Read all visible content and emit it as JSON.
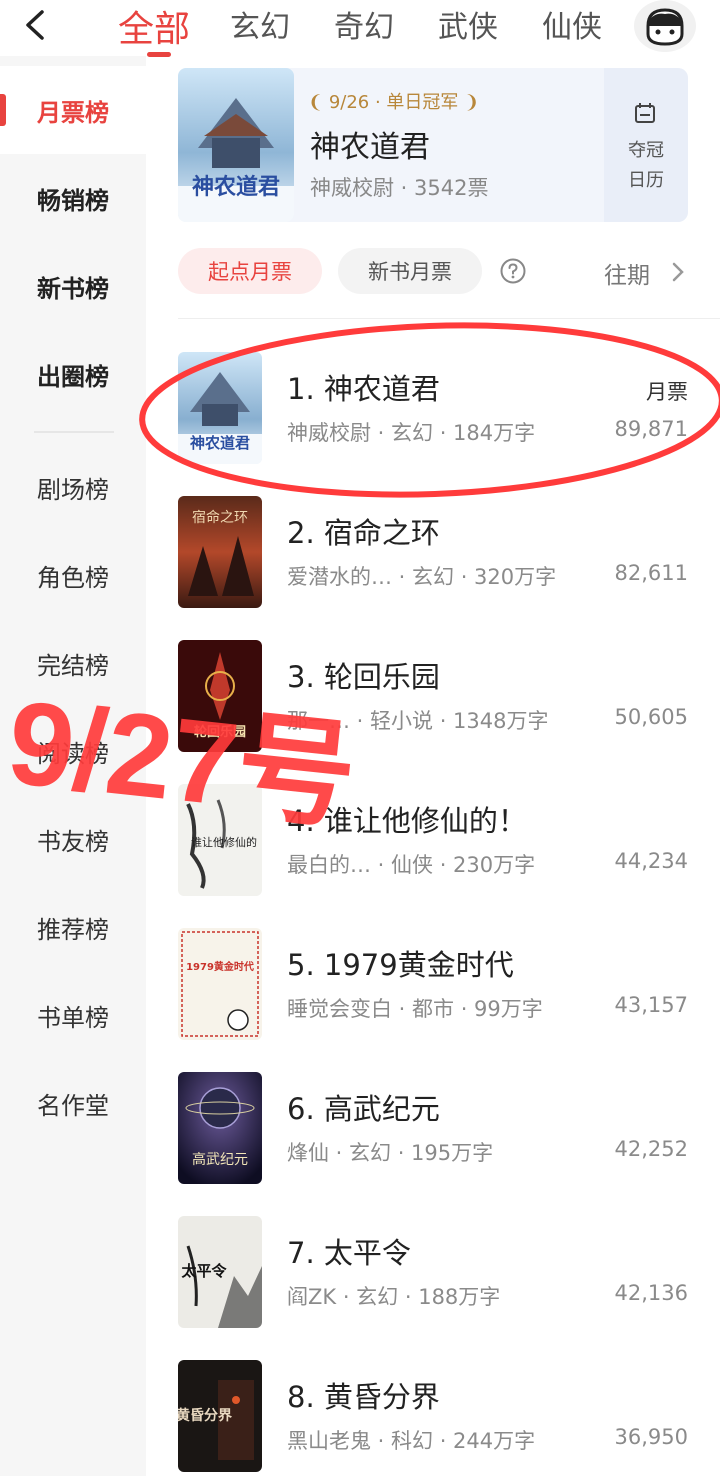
{
  "topbar": {
    "tabs": [
      "全部",
      "玄幻",
      "奇幻",
      "武侠",
      "仙侠"
    ],
    "active_tab_index": 0
  },
  "sidebar": {
    "items": [
      "月票榜",
      "畅销榜",
      "新书榜",
      "出圈榜",
      "剧场榜",
      "角色榜",
      "完结榜",
      "阅读榜",
      "书友榜",
      "推荐榜",
      "书单榜",
      "名作堂"
    ],
    "active_index": 0
  },
  "banner": {
    "badge": "9/26 · 单日冠军",
    "title": "神农道君",
    "meta": "神威校尉 · 3542票",
    "calendar_line1": "夺冠",
    "calendar_line2": "日历",
    "cover_title": "神农道君"
  },
  "subtabs": {
    "active": "起点月票",
    "other": "新书月票",
    "past": "往期"
  },
  "list": {
    "votes_label": "月票",
    "books": [
      {
        "title": "1. 神农道君",
        "meta": "神威校尉 · 玄幻 · 184万字",
        "votes": "89,871",
        "cover_text": "神农道君"
      },
      {
        "title": "2. 宿命之环",
        "meta": "爱潜水的… · 玄幻 · 320万字",
        "votes": "82,611",
        "cover_text": "宿命之环"
      },
      {
        "title": "3. 轮回乐园",
        "meta": "那一… · 轻小说 · 1348万字",
        "votes": "50,605",
        "cover_text": "轮回乐园"
      },
      {
        "title": "4. 谁让他修仙的！",
        "meta": "最白的… · 仙侠 · 230万字",
        "votes": "44,234",
        "cover_text": "谁让他修仙的"
      },
      {
        "title": "5. 1979黄金时代",
        "meta": "睡觉会变白 · 都市 · 99万字",
        "votes": "43,157",
        "cover_text": "1979黄金时代"
      },
      {
        "title": "6. 高武纪元",
        "meta": "烽仙 · 玄幻 · 195万字",
        "votes": "42,252",
        "cover_text": "高武纪元"
      },
      {
        "title": "7. 太平令",
        "meta": "阎ZK · 玄幻 · 188万字",
        "votes": "42,136",
        "cover_text": "太平令"
      },
      {
        "title": "8. 黄昏分界",
        "meta": "黑山老鬼 · 科幻 · 244万字",
        "votes": "36,950",
        "cover_text": "黄昏分界"
      }
    ]
  },
  "annotation": {
    "text": "9/27号",
    "color": "#ff3b3b"
  },
  "colors": {
    "accent": "#e8433f",
    "banner_bg": "#f2f5fb",
    "sidebar_bg": "#f6f6f6",
    "gold": "#b8873a"
  }
}
